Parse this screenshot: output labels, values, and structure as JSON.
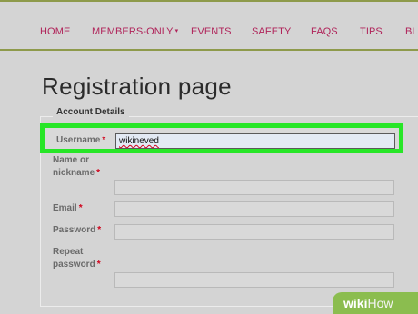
{
  "nav": {
    "items": [
      "HOME",
      "MEMBERS-ONLY",
      "EVENTS",
      "SAFETY",
      "FAQS",
      "TIPS",
      "BL"
    ],
    "members_caret": "▾"
  },
  "page": {
    "title": "Registration page"
  },
  "form": {
    "legend": "Account Details",
    "required_mark": "*",
    "username": {
      "label": "Username",
      "value": "wikineved"
    },
    "name": {
      "label_line1": "Name or",
      "label_line2": "nickname",
      "value": ""
    },
    "email": {
      "label": "Email",
      "value": ""
    },
    "password": {
      "label": "Password",
      "value": ""
    },
    "repeat_password": {
      "label_line1": "Repeat",
      "label_line2": "password",
      "value": ""
    }
  },
  "watermark": {
    "wiki": "wiki",
    "how": "How"
  },
  "colors": {
    "nav_text": "#b0245a",
    "nav_border": "#8e9a4b",
    "highlight": "#27e627",
    "required": "#d0021b",
    "watermark_bg": "#8bbd4f"
  }
}
